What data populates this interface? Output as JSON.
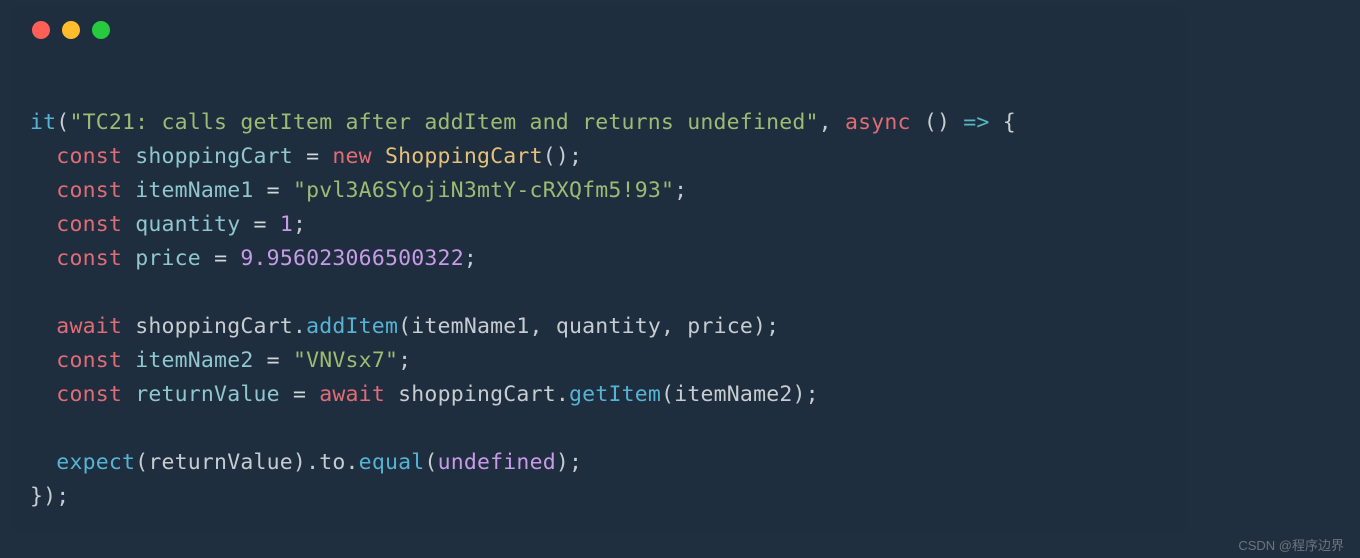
{
  "titlebar": {
    "dot_red": "#ff5f56",
    "dot_yellow": "#ffbd2e",
    "dot_green": "#27c93f"
  },
  "code": {
    "line1": {
      "fn": "it",
      "p1": "(",
      "str": "\"TC21: calls getItem after addItem and returns undefined\"",
      "p2": ", ",
      "async": "async",
      "p3": " () ",
      "arrow": "=>",
      "p4": " {"
    },
    "line2": {
      "indent": "  ",
      "kw": "const",
      "sp1": " ",
      "var": "shoppingCart",
      "sp2": " ",
      "op": "=",
      "sp3": " ",
      "new": "new",
      "sp4": " ",
      "type": "ShoppingCart",
      "tail": "();"
    },
    "line3": {
      "indent": "  ",
      "kw": "const",
      "sp1": " ",
      "var": "itemName1",
      "sp2": " ",
      "op": "=",
      "sp3": " ",
      "str": "\"pvl3A6SYojiN3mtY-cRXQfm5!93\"",
      "tail": ";"
    },
    "line4": {
      "indent": "  ",
      "kw": "const",
      "sp1": " ",
      "var": "quantity",
      "sp2": " ",
      "op": "=",
      "sp3": " ",
      "num": "1",
      "tail": ";"
    },
    "line5": {
      "indent": "  ",
      "kw": "const",
      "sp1": " ",
      "var": "price",
      "sp2": " ",
      "op": "=",
      "sp3": " ",
      "num": "9.956023066500322",
      "tail": ";"
    },
    "line6": "",
    "line7": {
      "indent": "  ",
      "await": "await",
      "sp1": " ",
      "obj": "shoppingCart",
      "dot": ".",
      "method": "addItem",
      "p1": "(",
      "arg1": "itemName1",
      "c1": ", ",
      "arg2": "quantity",
      "c2": ", ",
      "arg3": "price",
      "tail": ");"
    },
    "line8": {
      "indent": "  ",
      "kw": "const",
      "sp1": " ",
      "var": "itemName2",
      "sp2": " ",
      "op": "=",
      "sp3": " ",
      "str": "\"VNVsx7\"",
      "tail": ";"
    },
    "line9": {
      "indent": "  ",
      "kw": "const",
      "sp1": " ",
      "var": "returnValue",
      "sp2": " ",
      "op": "=",
      "sp3": " ",
      "await": "await",
      "sp4": " ",
      "obj": "shoppingCart",
      "dot": ".",
      "method": "getItem",
      "p1": "(",
      "arg": "itemName2",
      "tail": ");"
    },
    "line10": "",
    "line11": {
      "indent": "  ",
      "fn": "expect",
      "p1": "(",
      "arg": "returnValue",
      "p2": ").",
      "to": "to",
      "p3": ".",
      "equal": "equal",
      "p4": "(",
      "lit": "undefined",
      "tail": ");"
    },
    "line12": {
      "text": "});"
    }
  },
  "watermark": "CSDN @程序边界"
}
